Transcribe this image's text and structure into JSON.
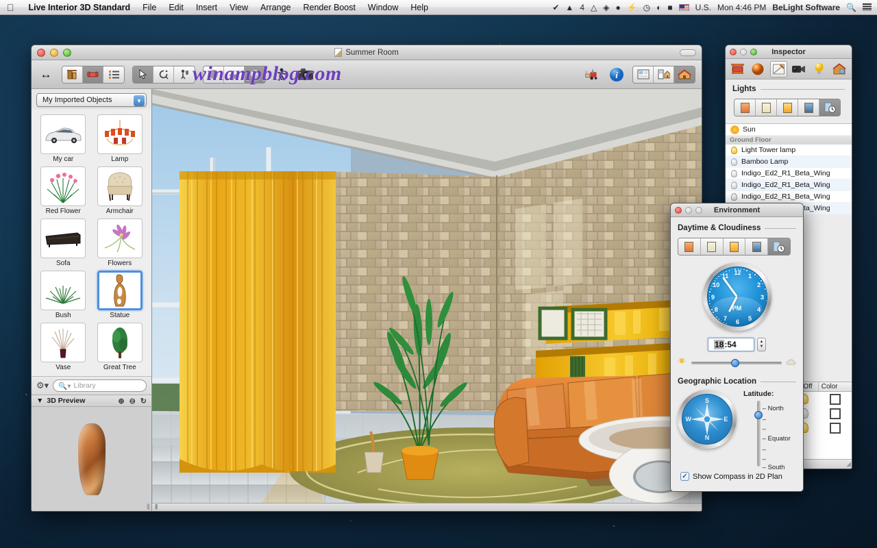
{
  "menubar": {
    "apple_icon": "apple-icon",
    "app_name": "Live Interior 3D Standard",
    "menus": [
      "File",
      "Edit",
      "Insert",
      "View",
      "Arrange",
      "Render Boost",
      "Window",
      "Help"
    ],
    "status_icons": [
      "checkmark-circle-icon",
      "adobe-icon",
      "google-drive-icon",
      "dropbox-icon",
      "evernote-icon",
      "flash-icon",
      "time-machine-icon",
      "wifi-icon",
      "battery-icon"
    ],
    "adobe_badge": "4",
    "input_locale": "U.S.",
    "clock": "Mon 4:46 PM",
    "user": "BeLight Software",
    "spotlight_icon": "search-icon",
    "notifications_icon": "notification-center-icon"
  },
  "main_window": {
    "title": "Summer Room",
    "watermark": "winampblog.com",
    "toolbar": {
      "resize_icon": "arrows-horizontal-icon",
      "left_group": [
        "building-icon",
        "armchair-icon",
        "list-icon"
      ],
      "tool_group": [
        "arrow-select-icon",
        "rotate-icon",
        "walk-tool-icon"
      ],
      "shading_group": [
        "flat-shading-icon",
        "half-shading-icon",
        "full-shading-icon"
      ],
      "walkthrough_icon": "walk-person-icon",
      "camera_icon": "camera-icon",
      "forklift_icon": "forklift-icon",
      "info_icon": "info-icon",
      "view_group": [
        "plan-2d-icon",
        "split-view-icon",
        "3d-view-icon"
      ]
    },
    "sidebar": {
      "collection_popup": "My Imported Objects",
      "objects": [
        {
          "label": "My car",
          "icon": "car-thumbnail"
        },
        {
          "label": "Lamp",
          "icon": "chandelier-thumbnail"
        },
        {
          "label": "Red Flower",
          "icon": "red-flower-thumbnail"
        },
        {
          "label": "Armchair",
          "icon": "armchair-thumbnail"
        },
        {
          "label": "Sofa",
          "icon": "sofa-thumbnail"
        },
        {
          "label": "Flowers",
          "icon": "flowers-thumbnail"
        },
        {
          "label": "Bush",
          "icon": "bush-thumbnail"
        },
        {
          "label": "Statue",
          "icon": "statue-thumbnail",
          "selected": true
        },
        {
          "label": "Vase",
          "icon": "vase-thumbnail"
        },
        {
          "label": "Great Tree",
          "icon": "great-tree-thumbnail"
        }
      ],
      "gear_icon": "gear-icon",
      "search_placeholder": "Library",
      "search_value": "",
      "preview_title": "3D Preview",
      "preview_tools": [
        "zoom-in-icon",
        "zoom-out-icon",
        "rotate-icon"
      ]
    }
  },
  "inspector": {
    "title": "Inspector",
    "tabs": [
      "object-icon",
      "material-icon",
      "edit-icon",
      "camera-icon",
      "light-icon",
      "environment-icon"
    ],
    "active_tab_index": 2,
    "section_title": "Lights",
    "light_mode_buttons": [
      "morning-icon",
      "day-icon",
      "evening-icon",
      "night-icon",
      "custom-time-icon"
    ],
    "active_light_mode": 4,
    "lights": [
      {
        "name": "Sun",
        "icon": "sun-icon",
        "state": "on",
        "group": null
      },
      {
        "name": "Ground Floor",
        "is_group": true
      },
      {
        "name": "Light Tower lamp",
        "icon": "bulb-icon",
        "state": "on"
      },
      {
        "name": "Bamboo Lamp",
        "icon": "bulb-icon",
        "state": "off"
      },
      {
        "name": "Indigo_Ed2_R1_Beta_Wing",
        "icon": "bulb-icon",
        "state": "off"
      },
      {
        "name": "Indigo_Ed2_R1_Beta_Wing",
        "icon": "bulb-icon",
        "state": "off"
      },
      {
        "name": "Indigo_Ed2_R1_Beta_Wing",
        "icon": "bulb-icon",
        "state": "off"
      },
      {
        "name": "Indigo_Ed2_R1_Beta_Wing",
        "icon": "bulb-icon",
        "state": "off"
      }
    ],
    "table_headers": [
      "On|Off",
      "Color"
    ],
    "table_rows": [
      {
        "onoff": "on",
        "color": "#ffffff"
      },
      {
        "onoff": "off",
        "color": "#ffffff"
      },
      {
        "onoff": "on",
        "color": "#ffffff"
      }
    ]
  },
  "environment": {
    "title": "Environment",
    "daytime_section": "Daytime & Cloudiness",
    "daytime_buttons": [
      "sunrise-icon",
      "overcast-icon",
      "sunny-icon",
      "night-icon",
      "custom-time-icon"
    ],
    "active_daytime": 4,
    "clock": {
      "numbers": [
        "12",
        "1",
        "2",
        "3",
        "4",
        "5",
        "6",
        "7",
        "8",
        "9",
        "10",
        "11"
      ],
      "meridiem": "PM",
      "hour_angle": 207,
      "minute_angle": 324
    },
    "time_value": "18:54",
    "time_hour": "18",
    "time_sep": ":",
    "time_minute": "54",
    "cloudiness_icons": [
      "sun-icon",
      "cloud-icon"
    ],
    "cloudiness_percent": 44,
    "geo_section": "Geographic Location",
    "compass_dirs": [
      "N",
      "E",
      "S",
      "W"
    ],
    "latitude_label": "Latitude:",
    "latitude_ticks": [
      "North",
      "Equator",
      "South"
    ],
    "latitude_percent": 16,
    "show_compass_label": "Show Compass in 2D Plan",
    "show_compass_checked": true,
    "checkmark": "✓"
  },
  "colors": {
    "accent_blue": "#2a76c4",
    "selection_blue": "#4b90df",
    "curtain_gold": "#e3a317",
    "sofa_orange": "#d4752c",
    "stone_wall": "#c9b694",
    "shelf_yellow": "#e8a700",
    "desktop": "#123650"
  }
}
